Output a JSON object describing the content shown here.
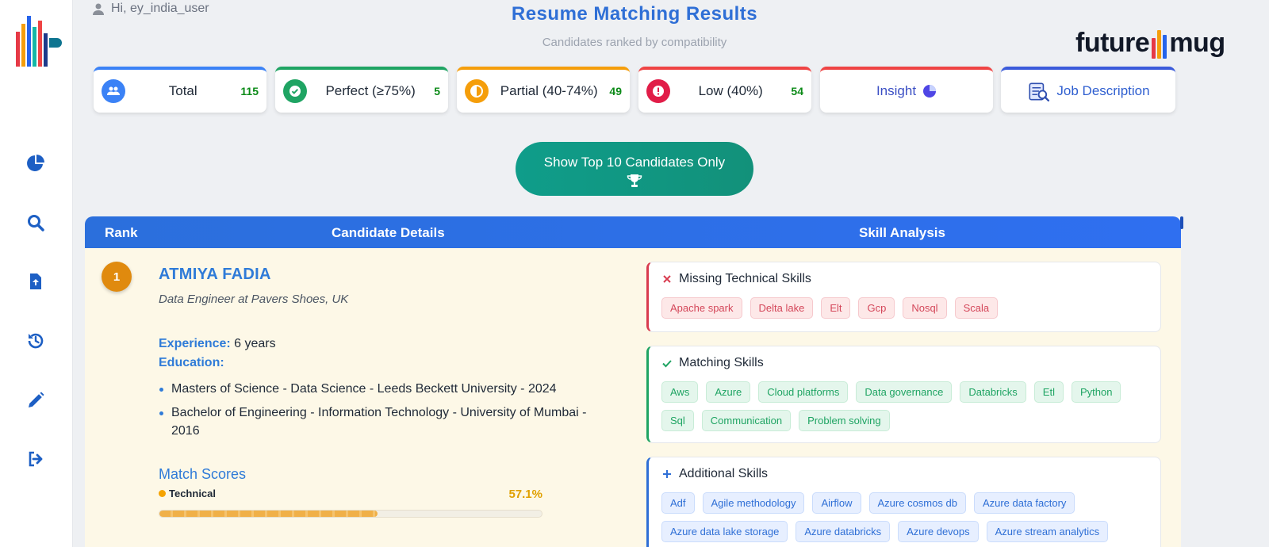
{
  "user": {
    "greeting": "Hi, ey_india_user"
  },
  "header": {
    "title": "Resume Matching Results",
    "subtitle": "Candidates ranked by compatibility",
    "brand_left": "future",
    "brand_right": "mug"
  },
  "sidebar": {
    "items": [
      {
        "icon": "pie-chart-icon"
      },
      {
        "icon": "search-icon"
      },
      {
        "icon": "file-upload-icon"
      },
      {
        "icon": "history-icon"
      },
      {
        "icon": "pencil-icon"
      },
      {
        "icon": "logout-icon"
      }
    ]
  },
  "stats": {
    "total": {
      "label": "Total",
      "count": "115",
      "color": "#3b82f6"
    },
    "perfect": {
      "label": "Perfect (≥75%)",
      "count": "5",
      "color": "#1fa463"
    },
    "partial": {
      "label": "Partial (40-74%)",
      "count": "49",
      "color": "#f59e0b"
    },
    "low": {
      "label": "Low (40%)",
      "count": "54",
      "color": "#ef4444"
    },
    "insight": {
      "label": "Insight",
      "color": "#ef4444"
    },
    "jd": {
      "label": "Job Description",
      "color": "#3b5bdb"
    }
  },
  "actions": {
    "top10_label": "Show Top 10 Candidates Only"
  },
  "table": {
    "headers": {
      "rank": "Rank",
      "details": "Candidate Details",
      "skills": "Skill Analysis"
    }
  },
  "candidate": {
    "rank": "1",
    "name": "ATMIYA FADIA",
    "role": "Data Engineer at Pavers Shoes, UK",
    "experience_label": "Experience:",
    "experience_value": " 6 years",
    "education_label": "Education:",
    "education": [
      "Masters of Science - Data Science - Leeds Beckett University - 2024",
      "Bachelor of Engineering - Information Technology - University of Mumbai - 2016"
    ],
    "match_scores_title": "Match Scores",
    "technical_label": "Technical",
    "technical_pct": "57.1%",
    "technical_value": 57.1
  },
  "skills": {
    "missing": {
      "title": "Missing Technical Skills",
      "items": [
        "Apache spark",
        "Delta lake",
        "Elt",
        "Gcp",
        "Nosql",
        "Scala"
      ]
    },
    "matching": {
      "title": "Matching Skills",
      "items": [
        "Aws",
        "Azure",
        "Cloud platforms",
        "Data governance",
        "Databricks",
        "Etl",
        "Python",
        "Sql",
        "Communication",
        "Problem solving"
      ]
    },
    "additional": {
      "title": "Additional Skills",
      "items": [
        "Adf",
        "Agile methodology",
        "Airflow",
        "Azure cosmos db",
        "Azure data factory",
        "Azure data lake storage",
        "Azure databricks",
        "Azure devops",
        "Azure stream analytics"
      ]
    }
  }
}
